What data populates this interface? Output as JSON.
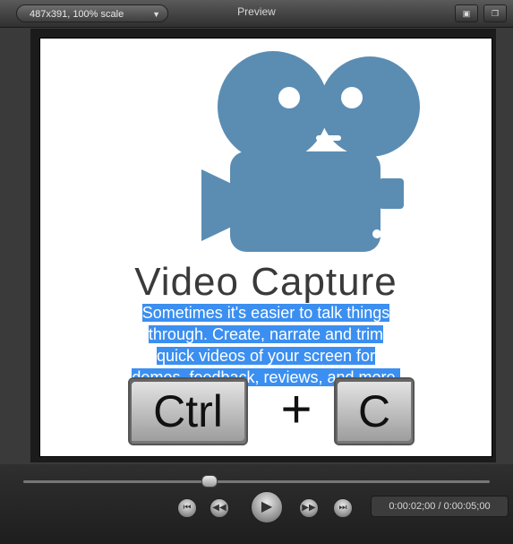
{
  "toolbar": {
    "scale_label": "487x391, 100% scale",
    "title": "Preview",
    "fit_icon": "fit-screen-icon",
    "popout_icon": "popout-window-icon"
  },
  "slide": {
    "headline": "Video Capture",
    "description": "Sometimes it's easier to talk things through. Create, narrate and trim quick videos of your screen for demos, feedback, reviews, and more.",
    "description_lines": [
      "Sometimes it's easier to talk things",
      "through. Create, narrate and trim",
      "quick videos of your screen for",
      "demos, feedback, reviews, and more."
    ],
    "key1": "Ctrl",
    "plus": "+",
    "key2": "C",
    "camera_color": "#5b8db3",
    "highlight_color": "#3b8ff0"
  },
  "player": {
    "time": "0:00:02;00 / 0:00:05;00",
    "progress_fraction": 0.4,
    "buttons": [
      "skip-to-start-icon",
      "rewind-icon",
      "play-icon",
      "fast-forward-icon",
      "skip-to-end-icon"
    ]
  }
}
